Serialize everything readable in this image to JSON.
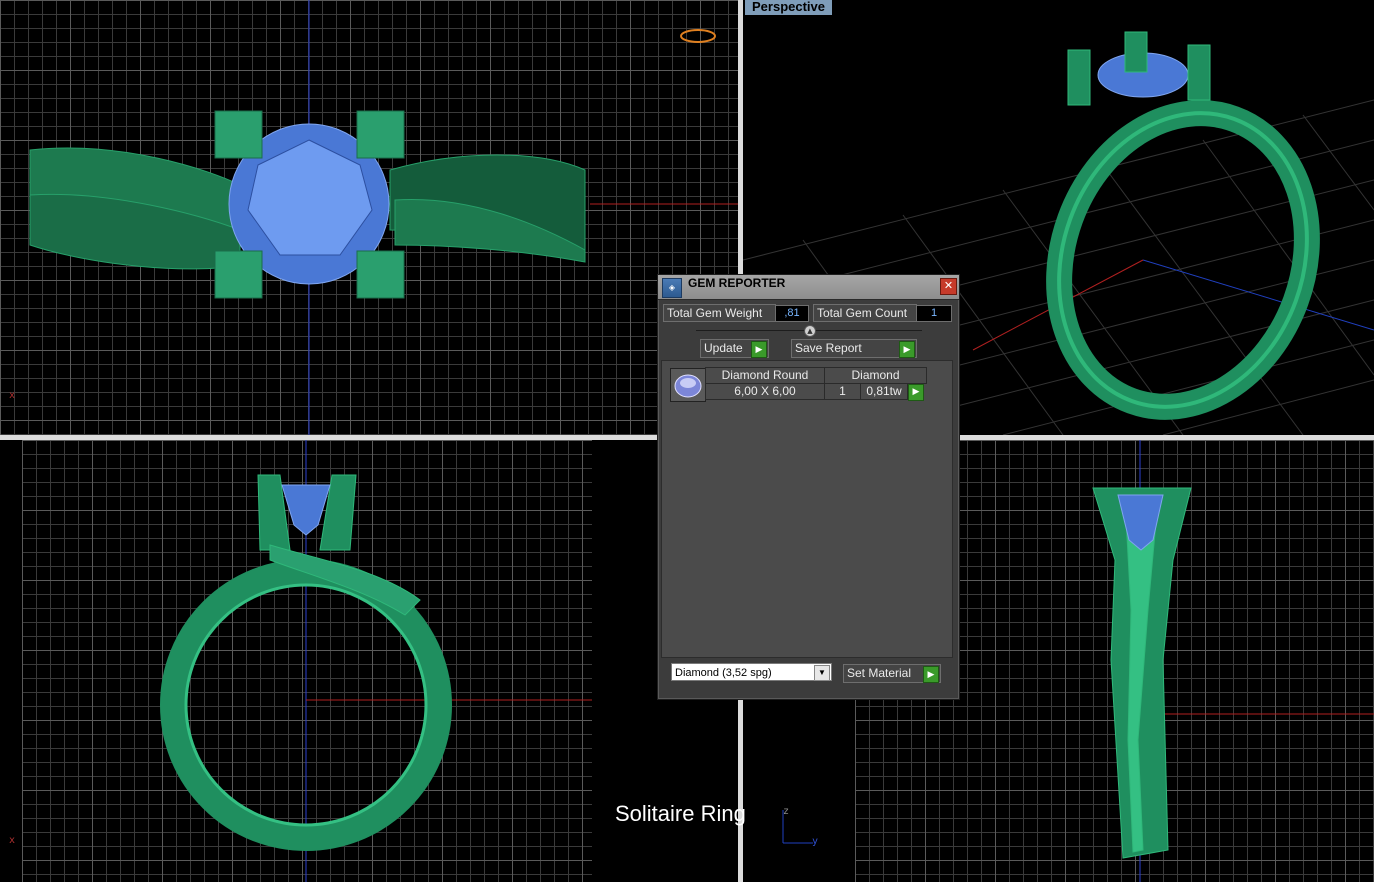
{
  "viewports": {
    "perspective_label": "Perspective"
  },
  "axis_letters": {
    "x": "x",
    "z": "z",
    "y": "y"
  },
  "gem_reporter": {
    "title": "GEM REPORTER",
    "close_glyph": "✕",
    "total_weight_label": "Total Gem Weight",
    "total_weight_value": ",81",
    "total_count_label": "Total Gem Count",
    "total_count_value": "1",
    "update_label": "Update",
    "save_report_label": "Save Report",
    "gems": [
      {
        "shape": "Diamond Round",
        "size": "6,00 X 6,00",
        "material": "Diamond",
        "count": "1",
        "weight": "0,81tw"
      }
    ],
    "material_select": "Diamond     (3,52 spg)",
    "set_material_label": "Set Material"
  },
  "caption": "Solitaire Ring",
  "colors": {
    "ring_green": "#1f8f5f",
    "gem_blue": "#4f7fd8",
    "axis_red": "#b02020",
    "axis_blue": "#2040c0"
  }
}
